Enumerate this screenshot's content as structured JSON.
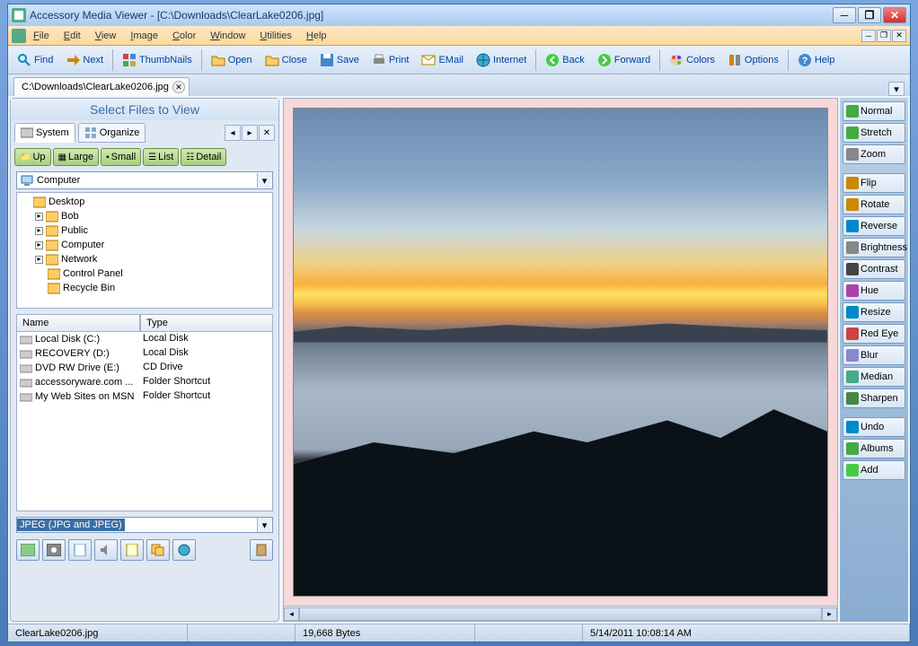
{
  "title": "Accessory Media Viewer - [C:\\Downloads\\ClearLake0206.jpg]",
  "menu": {
    "file": "File",
    "edit": "Edit",
    "view": "View",
    "image": "Image",
    "color": "Color",
    "window": "Window",
    "utilities": "Utilities",
    "help": "Help"
  },
  "toolbar": {
    "find": "Find",
    "next": "Next",
    "thumbnails": "ThumbNails",
    "open": "Open",
    "close": "Close",
    "save": "Save",
    "print": "Print",
    "email": "EMail",
    "internet": "Internet",
    "back": "Back",
    "forward": "Forward",
    "colors": "Colors",
    "options": "Options",
    "help": "Help"
  },
  "doctab": "C:\\Downloads\\ClearLake0206.jpg",
  "panel": {
    "header": "Select Files to View",
    "tab_system": "System",
    "tab_organize": "Organize",
    "btn_up": "Up",
    "btn_large": "Large",
    "btn_small": "Small",
    "btn_list": "List",
    "btn_detail": "Detail",
    "location": "Computer",
    "tree": [
      {
        "label": "Desktop",
        "indent": 0,
        "exp": ""
      },
      {
        "label": "Bob",
        "indent": 1,
        "exp": "▸"
      },
      {
        "label": "Public",
        "indent": 1,
        "exp": "▸"
      },
      {
        "label": "Computer",
        "indent": 1,
        "exp": "▸"
      },
      {
        "label": "Network",
        "indent": 1,
        "exp": "▸"
      },
      {
        "label": "Control Panel",
        "indent": 1,
        "exp": ""
      },
      {
        "label": "Recycle Bin",
        "indent": 1,
        "exp": ""
      }
    ],
    "col_name": "Name",
    "col_type": "Type",
    "files": [
      {
        "name": "Local Disk (C:)",
        "type": "Local Disk"
      },
      {
        "name": "RECOVERY (D:)",
        "type": "Local Disk"
      },
      {
        "name": "DVD RW Drive (E:)",
        "type": "CD Drive"
      },
      {
        "name": "accessoryware.com ...",
        "type": "Folder Shortcut"
      },
      {
        "name": "My Web Sites on MSN",
        "type": "Folder Shortcut"
      }
    ],
    "filter": "JPEG (JPG and JPEG)"
  },
  "right": {
    "normal": "Normal",
    "stretch": "Stretch",
    "zoom": "Zoom",
    "flip": "Flip",
    "rotate": "Rotate",
    "reverse": "Reverse",
    "brightness": "Brightness",
    "contrast": "Contrast",
    "hue": "Hue",
    "resize": "Resize",
    "redeye": "Red Eye",
    "blur": "Blur",
    "median": "Median",
    "sharpen": "Sharpen",
    "undo": "Undo",
    "albums": "Albums",
    "add": "Add"
  },
  "status": {
    "file": "ClearLake0206.jpg",
    "size": "19,668 Bytes",
    "date": "5/14/2011 10:08:14 AM"
  }
}
